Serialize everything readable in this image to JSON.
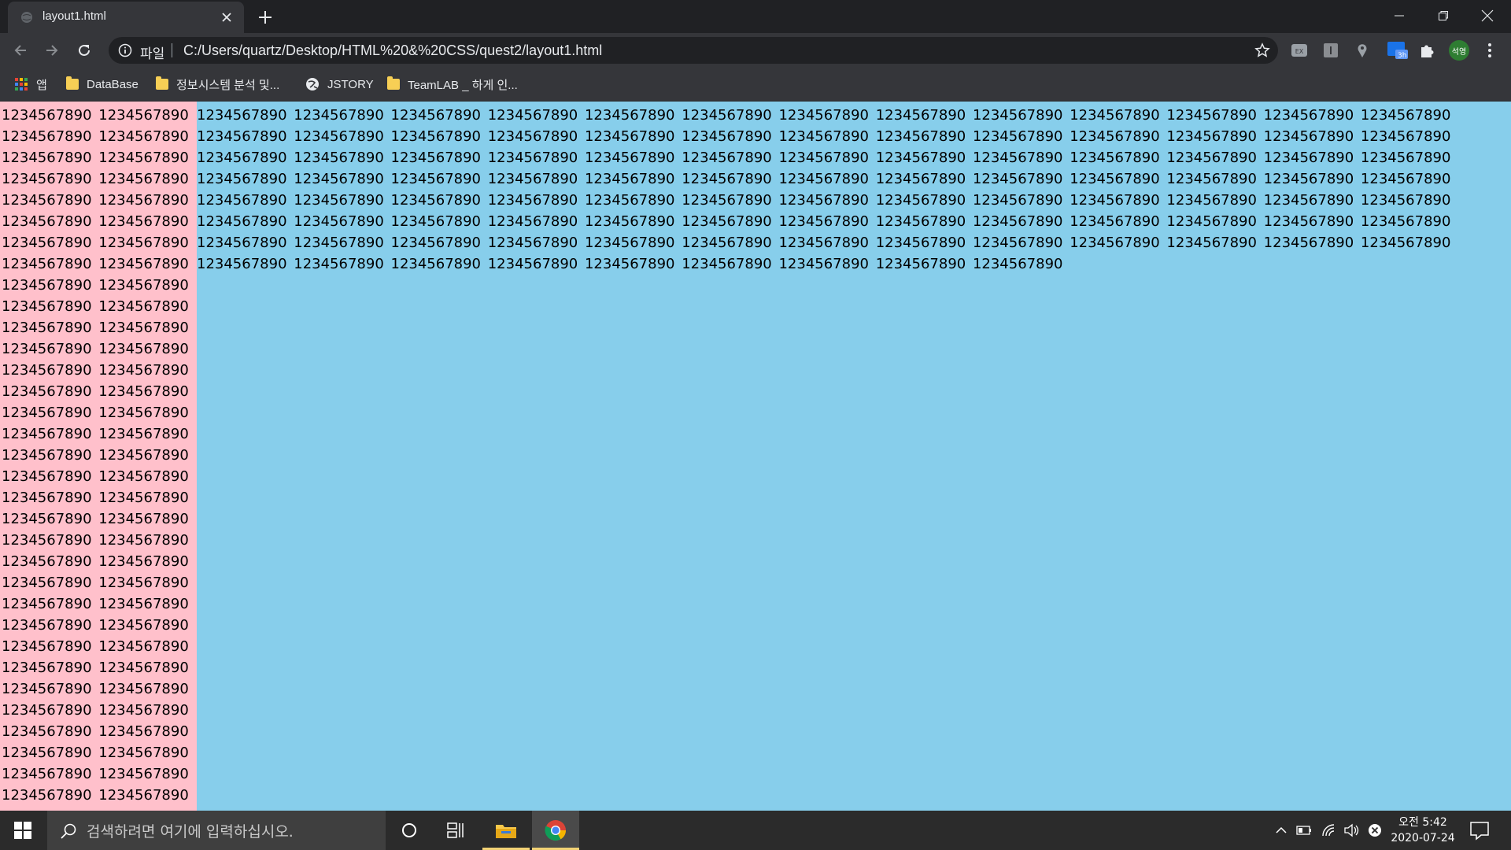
{
  "browser": {
    "tab_title": "layout1.html",
    "address_scheme": "파일",
    "address_url": "C:/Users/quartz/Desktop/HTML%20&%20CSS/quest2/layout1.html",
    "profile_initials": "석영",
    "extension_badge": "3h"
  },
  "bookmarks": [
    {
      "label": "앱",
      "icon": "apps-grid-icon"
    },
    {
      "label": "DataBase",
      "icon": "folder-icon"
    },
    {
      "label": "정보시스템 분석 및...",
      "icon": "folder-icon"
    },
    {
      "label": "JSTORY",
      "icon": "globe-icon"
    },
    {
      "label": "TeamLAB _ 하게 인...",
      "icon": "folder-icon"
    }
  ],
  "page": {
    "left_text": "1234567890 1234567890 1234567890 1234567890 1234567890 1234567890 1234567890 1234567890 1234567890 1234567890 1234567890 1234567890 1234567890 1234567890 1234567890 1234567890 1234567890 1234567890 1234567890 1234567890 1234567890 1234567890 1234567890 1234567890 1234567890 1234567890 1234567890 1234567890 1234567890 1234567890 1234567890 1234567890 1234567890 1234567890 1234567890 1234567890 1234567890 1234567890 1234567890 1234567890 1234567890 1234567890 1234567890 1234567890 1234567890 1234567890 1234567890 1234567890 1234567890 1234567890 1234567890 1234567890 1234567890 1234567890 1234567890 1234567890 1234567890 1234567890 1234567890 1234567890 1234567890 1234567890 1234567890 1234567890 1234567890 1234567890 1234567890 1234567890",
    "main_text": "1234567890 1234567890 1234567890 1234567890 1234567890 1234567890 1234567890 1234567890 1234567890 1234567890 1234567890 1234567890 1234567890 1234567890 1234567890 1234567890 1234567890 1234567890 1234567890 1234567890 1234567890 1234567890 1234567890 1234567890 1234567890 1234567890 1234567890 1234567890 1234567890 1234567890 1234567890 1234567890 1234567890 1234567890 1234567890 1234567890 1234567890 1234567890 1234567890 1234567890 1234567890 1234567890 1234567890 1234567890 1234567890 1234567890 1234567890 1234567890 1234567890 1234567890 1234567890 1234567890 1234567890 1234567890 1234567890 1234567890 1234567890 1234567890 1234567890 1234567890 1234567890 1234567890 1234567890 1234567890 1234567890 1234567890 1234567890 1234567890 1234567890 1234567890 1234567890 1234567890 1234567890 1234567890 1234567890 1234567890 1234567890 1234567890 1234567890 1234567890 1234567890 1234567890 1234567890 1234567890 1234567890 1234567890 1234567890 1234567890 1234567890 1234567890 1234567890 1234567890 1234567890 1234567890 1234567890 1234567890 1234567890 1234567890 1234567890 1234567890",
    "left_bg": "#ffc0cb",
    "main_bg": "#87ceeb"
  },
  "taskbar": {
    "search_placeholder": "검색하려면 여기에 입력하십시오.",
    "time": "오전 5:42",
    "date": "2020-07-24"
  }
}
